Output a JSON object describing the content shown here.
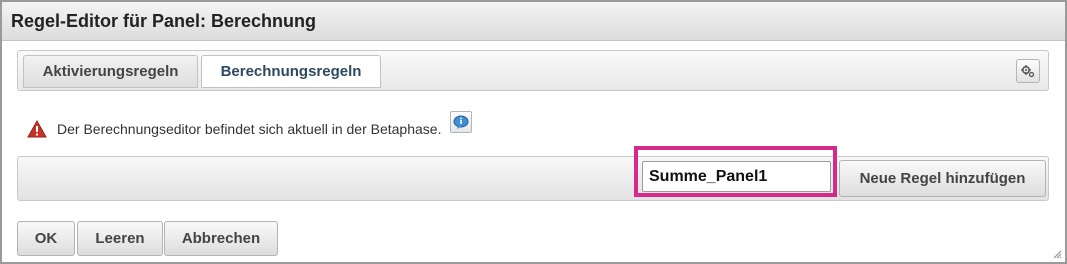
{
  "dialog": {
    "title": "Regel-Editor für Panel: Berechnung"
  },
  "tabs": [
    {
      "label": "Aktivierungsregeln",
      "active": false
    },
    {
      "label": "Berechnungsregeln",
      "active": true
    }
  ],
  "toolbar": {
    "settings_icon": "gears-icon"
  },
  "warning": {
    "icon": "warning-triangle-icon",
    "text": "Der Berechnungseditor befindet sich aktuell in der Betaphase.",
    "help_icon": "info-bubble-icon"
  },
  "rule_bar": {
    "input_value": "Summe_Panel1",
    "add_button_label": "Neue Regel hinzufügen",
    "highlight_color": "#d62a8a"
  },
  "footer": {
    "ok_label": "OK",
    "clear_label": "Leeren",
    "cancel_label": "Abbrechen"
  },
  "colors": {
    "warning_red": "#c8322a",
    "active_tab_text": "#2e4a62",
    "info_blue": "#3f8fd6"
  }
}
